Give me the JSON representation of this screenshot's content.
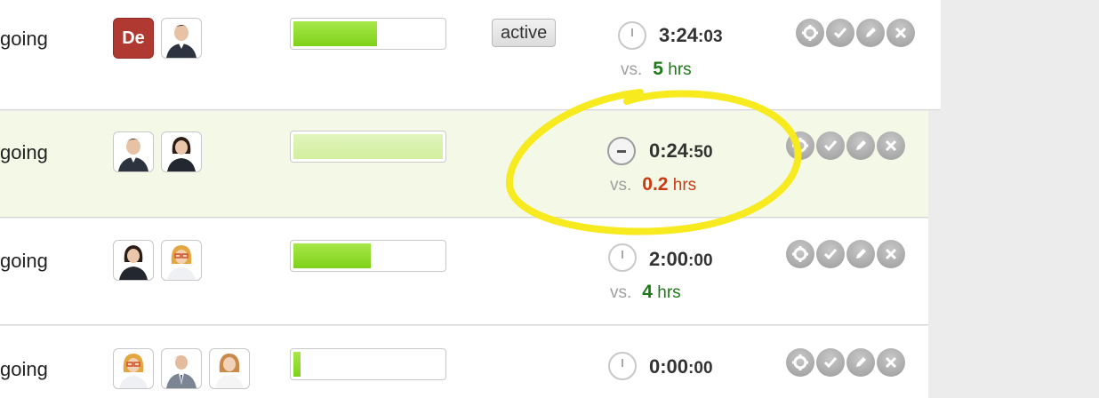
{
  "rows": [
    {
      "status": "going",
      "avatars": [
        {
          "type": "initials",
          "text": "De"
        },
        {
          "type": "person",
          "icon": "man-avatar-icon"
        }
      ],
      "progress": 0.55,
      "badge": "active",
      "time_main": "3:24",
      "time_sec": ":03",
      "vs_label": "vs.",
      "vs_value": "5",
      "vs_unit": "hrs",
      "vs_color": "#1d7a16"
    },
    {
      "status": "going",
      "avatars": [
        {
          "type": "person",
          "icon": "man-avatar-icon"
        },
        {
          "type": "person",
          "icon": "woman-avatar-icon"
        }
      ],
      "progress": 1.0,
      "time_main": "0:24",
      "time_sec": ":50",
      "vs_label": "vs.",
      "vs_value": "0.2",
      "vs_unit": "hrs",
      "vs_color": "#cc3a12",
      "highlighted": true,
      "annotation": "yellow-circle"
    },
    {
      "status": "going",
      "avatars": [
        {
          "type": "person",
          "icon": "woman-avatar-icon"
        },
        {
          "type": "person",
          "icon": "woman-glasses-avatar-icon"
        }
      ],
      "progress": 0.52,
      "time_main": "2:00",
      "time_sec": ":00",
      "vs_label": "vs.",
      "vs_value": "4",
      "vs_unit": "hrs",
      "vs_color": "#1d7a16"
    },
    {
      "status": "going",
      "avatars": [
        {
          "type": "person",
          "icon": "woman-glasses-avatar-icon"
        },
        {
          "type": "person",
          "icon": "man-suit-avatar-icon"
        },
        {
          "type": "person",
          "icon": "woman-avatar-icon"
        }
      ],
      "progress": 0.05,
      "time_main": "0:00",
      "time_sec": ":00"
    }
  ],
  "action_icons": [
    "gear-icon",
    "check-icon",
    "pencil-icon",
    "close-icon"
  ]
}
